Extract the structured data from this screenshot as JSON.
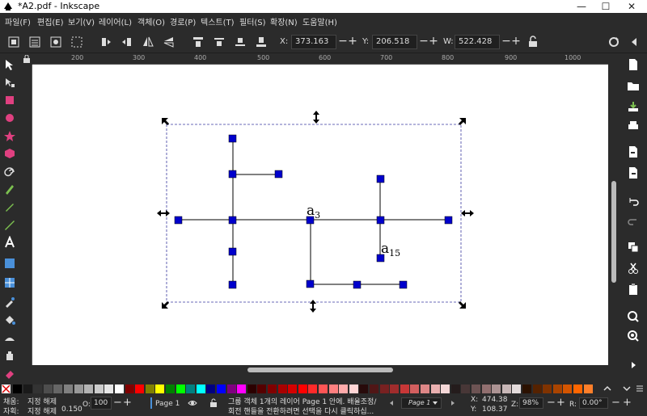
{
  "window": {
    "title": "*A2.pdf - Inkscape",
    "minimize": "—",
    "maximize": "☐",
    "close": "✕"
  },
  "menu": [
    "파일(F)",
    "편집(E)",
    "보기(V)",
    "레이어(L)",
    "객체(O)",
    "경로(P)",
    "텍스트(T)",
    "필터(S)",
    "확장(N)",
    "도움말(H)"
  ],
  "coords": {
    "x_label": "X:",
    "x_value": "373.163",
    "y_label": "Y:",
    "y_value": "206.518",
    "w_label": "W:",
    "w_value": "522.428"
  },
  "ruler": {
    "h_ticks": [
      "200",
      "300",
      "400",
      "500",
      "600",
      "700",
      "800",
      "900",
      "1000"
    ]
  },
  "canvas_labels": {
    "a3": "a",
    "a3_sub": "3",
    "a15": "a",
    "a15_sub": "15"
  },
  "palette_colors": [
    "#000000",
    "#1a1a1a",
    "#333333",
    "#4d4d4d",
    "#666666",
    "#808080",
    "#999999",
    "#b3b3b3",
    "#cccccc",
    "#e6e6e6",
    "#ffffff",
    "#800000",
    "#ff0000",
    "#808000",
    "#ffff00",
    "#008000",
    "#00ff00",
    "#008080",
    "#00ffff",
    "#000080",
    "#0000ff",
    "#800080",
    "#ff00ff",
    "#2b0000",
    "#550000",
    "#800000",
    "#aa0000",
    "#d40000",
    "#ff0000",
    "#ff2a2a",
    "#ff5555",
    "#ff8080",
    "#ffaaaa",
    "#ffd5d5",
    "#280b0b",
    "#501616",
    "#782121",
    "#a02c2c",
    "#c83737",
    "#d35f5f",
    "#de8787",
    "#e9afaf",
    "#f4d7d7",
    "#241c1c",
    "#483737",
    "#6c5353",
    "#916f6f",
    "#ac9393",
    "#c8b7b7",
    "#e3dbdb",
    "#2b1100",
    "#552200",
    "#803300",
    "#aa4400",
    "#d45500",
    "#ff6600",
    "#ff7f2a"
  ],
  "status": {
    "fill_label": "채움:",
    "fill_value": "지정 해제",
    "stroke_label": "자획:",
    "stroke_value": "지정 해제",
    "stroke_width": "0.150",
    "opacity_label": "O:",
    "opacity_value": "100",
    "layer": "Page 1",
    "message_line1": "그룹 객체 1개의 레이어 Page 1 안에. 배율조정/",
    "message_line2": "회전 핸들을 전환하려면 선택을 다시 클릭하십...",
    "page_select": "Page 1",
    "cursor_x_label": "X:",
    "cursor_x": "474.38",
    "cursor_y_label": "Y:",
    "cursor_y": "108.37",
    "zoom_label": "Z:",
    "zoom": "98%",
    "rotate_label": "R:",
    "rotate": "0.00°"
  }
}
